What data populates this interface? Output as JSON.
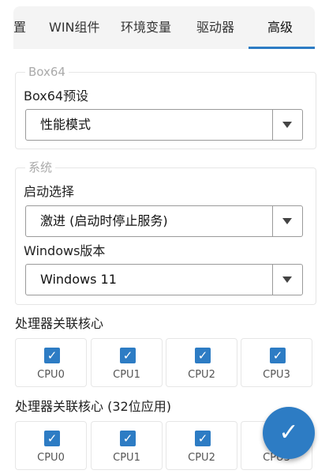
{
  "tabs": [
    {
      "label": "置"
    },
    {
      "label": "WIN组件"
    },
    {
      "label": "环境变量"
    },
    {
      "label": "驱动器"
    },
    {
      "label": "高级",
      "active": true
    }
  ],
  "box64_group": {
    "legend": "Box64",
    "preset_label": "Box64预设",
    "preset_value": "性能模式"
  },
  "system_group": {
    "legend": "系统",
    "startup_label": "启动选择",
    "startup_value": "激进 (启动时停止服务)",
    "windows_label": "Windows版本",
    "windows_value": "Windows 11"
  },
  "cpu_affinity": {
    "label": "处理器关联核心",
    "cpus": [
      {
        "label": "CPU0",
        "checked": true
      },
      {
        "label": "CPU1",
        "checked": true
      },
      {
        "label": "CPU2",
        "checked": true
      },
      {
        "label": "CPU3",
        "checked": true
      }
    ]
  },
  "cpu_affinity_32": {
    "label": "处理器关联核心 (32位应用)",
    "cpus": [
      {
        "label": "CPU0",
        "checked": true
      },
      {
        "label": "CPU1",
        "checked": true
      },
      {
        "label": "CPU2",
        "checked": true
      },
      {
        "label": "CPU3",
        "checked": true
      }
    ]
  },
  "icons": {
    "check": "✓",
    "fab": "check-icon"
  },
  "colors": {
    "accent": "#2d7cc4"
  }
}
